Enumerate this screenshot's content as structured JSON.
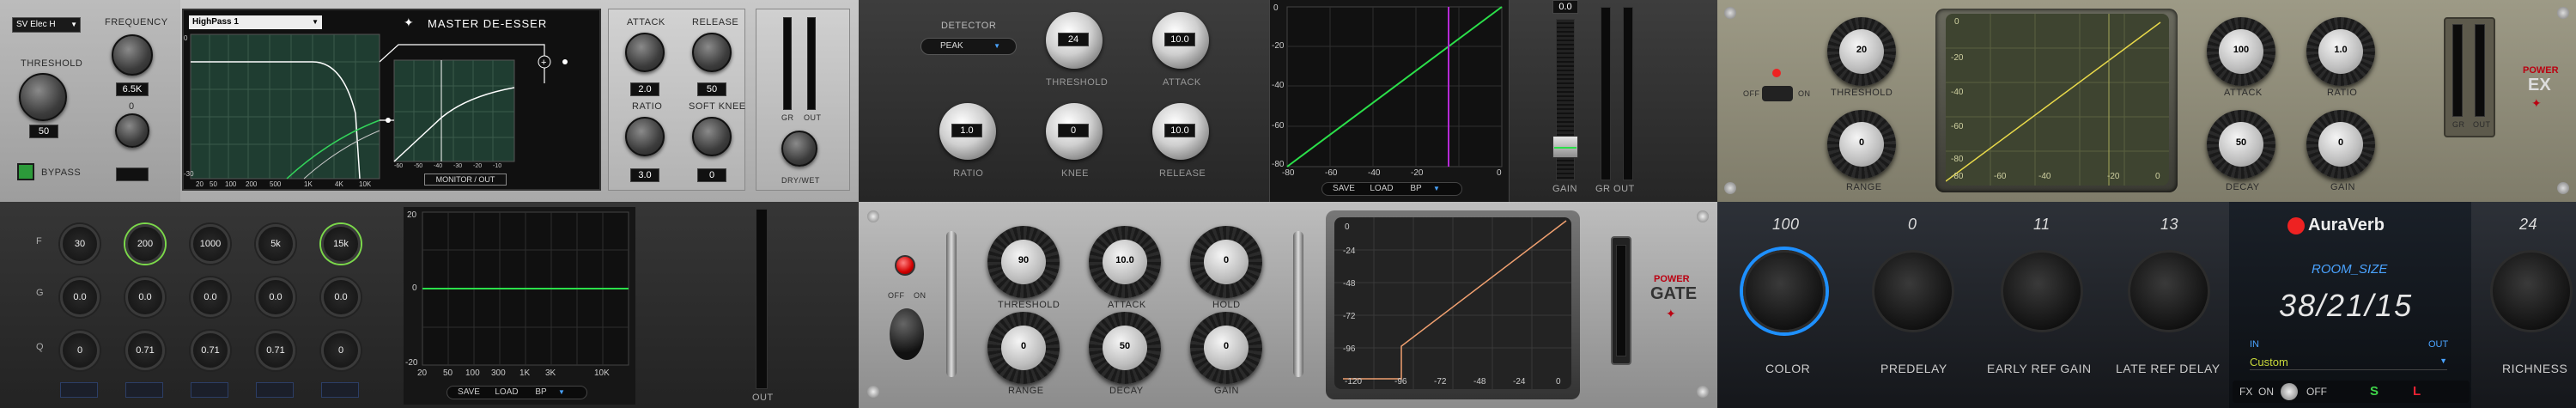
{
  "deesser": {
    "preset": "SV Elec H",
    "threshold_label": "THRESHOLD",
    "threshold_value": "50",
    "frequency_label": "FREQUENCY",
    "frequency_value": "6.5K",
    "frequency_sub": "0",
    "bypass_label": "BYPASS",
    "filter_type": "HighPass 1",
    "title": "MASTER DE-ESSER",
    "monitor_label": "MONITOR / OUT",
    "freq_ticks": [
      "20",
      "50",
      "100",
      "200",
      "500",
      "1K",
      "4K",
      "10K"
    ],
    "db_ticks": [
      "0",
      "-30"
    ],
    "comp_ticks": [
      "-60",
      "-50",
      "-40",
      "-30",
      "-20",
      "-10"
    ],
    "attack_label": "ATTACK",
    "attack_value": "2.0",
    "release_label": "RELEASE",
    "release_value": "50",
    "ratio_label": "RATIO",
    "ratio_value": "3.0",
    "softknee_label": "SOFT KNEE",
    "softknee_value": "0",
    "gr_label": "GR",
    "out_label": "OUT",
    "drywet_label": "DRY/WET"
  },
  "detector": {
    "detector_label": "DETECTOR",
    "detector_mode": "PEAK",
    "threshold_label": "THRESHOLD",
    "threshold_value": "24",
    "attack_label": "ATTACK",
    "attack_value": "10.0",
    "ratio_label": "RATIO",
    "ratio_value": "1.0",
    "knee_label": "KNEE",
    "knee_value": "0",
    "release_label": "RELEASE",
    "release_value": "10.0",
    "y_ticks": [
      "0",
      "-20",
      "-40",
      "-60",
      "-80"
    ],
    "x_ticks": [
      "-80",
      "-60",
      "-40",
      "-20",
      "0"
    ],
    "save": "SAVE",
    "load": "LOAD",
    "bp": "BP",
    "gain_value": "0.0",
    "gain_label": "GAIN",
    "grout_label": "GR OUT"
  },
  "powerex": {
    "threshold_label": "THRESHOLD",
    "threshold_value": "20",
    "range_label": "RANGE",
    "range_value": "0",
    "off_label": "OFF",
    "on_label": "ON",
    "y_ticks": [
      "0",
      "-20",
      "-40",
      "-60",
      "-80"
    ],
    "x_ticks": [
      "-80",
      "-60",
      "-40",
      "-20",
      "0"
    ],
    "attack_label": "ATTACK",
    "attack_value": "100",
    "ratio_label": "RATIO",
    "ratio_value": "1.0",
    "decay_label": "DECAY",
    "decay_value": "50",
    "gain_label": "GAIN",
    "gain_value": "0",
    "gr_label": "GR",
    "out_label": "OUT",
    "brand_top": "POWER",
    "brand_bottom": "EX"
  },
  "eq": {
    "row_labels": [
      "F",
      "G",
      "Q"
    ],
    "f_values": [
      "30",
      "200",
      "1000",
      "5k",
      "15k"
    ],
    "g_values": [
      "0.0",
      "0.0",
      "0.0",
      "0.0",
      "0.0"
    ],
    "q_values": [
      "0",
      "0.71",
      "0.71",
      "0.71",
      "0"
    ],
    "y_ticks": [
      "20",
      "0",
      "-20"
    ],
    "x_ticks": [
      "20",
      "50",
      "100",
      "300",
      "1K",
      "3K",
      "10K"
    ],
    "save": "SAVE",
    "load": "LOAD",
    "bp": "BP",
    "out_label": "OUT"
  },
  "gate": {
    "off_label": "OFF",
    "on_label": "ON",
    "threshold_label": "THRESHOLD",
    "threshold_value": "90",
    "attack_label": "ATTACK",
    "attack_value": "10.0",
    "hold_label": "HOLD",
    "hold_value": "0",
    "range_label": "RANGE",
    "range_value": "0",
    "decay_label": "DECAY",
    "decay_value": "50",
    "gain_label": "GAIN",
    "gain_value": "0",
    "y_ticks": [
      "0",
      "-24",
      "-48",
      "-72",
      "-96"
    ],
    "x_ticks": [
      "-120",
      "-96",
      "-72",
      "-48",
      "-24",
      "0"
    ],
    "brand_top": "POWER",
    "brand_bottom": "GATE"
  },
  "auraverb": {
    "color_value": "100",
    "color_label": "COLOR",
    "predelay_value": "0",
    "predelay_label": "PREDELAY",
    "early_value": "11",
    "early_label": "EARLY REF GAIN",
    "late_value": "13",
    "late_label": "LATE REF DELAY",
    "brand": "AuraVerb",
    "room_label": "ROOM_SIZE",
    "room_value": "38/21/15",
    "in_label": "IN",
    "out_label": "OUT",
    "preset": "Custom",
    "richness_value": "24",
    "richness_label": "RICHNESS",
    "fx_label": "FX",
    "on_label": "ON",
    "off_label": "OFF",
    "s_label": "S",
    "l_label": "L"
  }
}
